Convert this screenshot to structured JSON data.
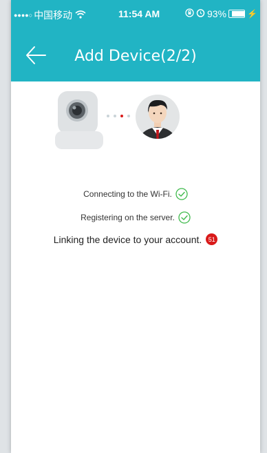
{
  "status_bar": {
    "signal": "●●●●○",
    "carrier": "中国移动",
    "time": "11:54 AM",
    "battery_percent": "93%",
    "battery_level": 0.93
  },
  "header": {
    "title": "Add Device(2/2)",
    "color": "#21b4c4"
  },
  "connection": {
    "dots": [
      "#c9d3d8",
      "#c9d3d8",
      "#d91a1a",
      "#c9d3d8"
    ]
  },
  "steps": [
    {
      "label": "Connecting to the Wi-Fi.",
      "status": "done"
    },
    {
      "label": "Registering on the server.",
      "status": "done"
    },
    {
      "label": "Linking the device to your account.",
      "status": "in-progress",
      "countdown": "51"
    }
  ],
  "icons": {
    "back": "back-arrow-icon",
    "check": "check-circle-icon",
    "camera": "camera-icon",
    "user": "user-avatar-icon"
  }
}
